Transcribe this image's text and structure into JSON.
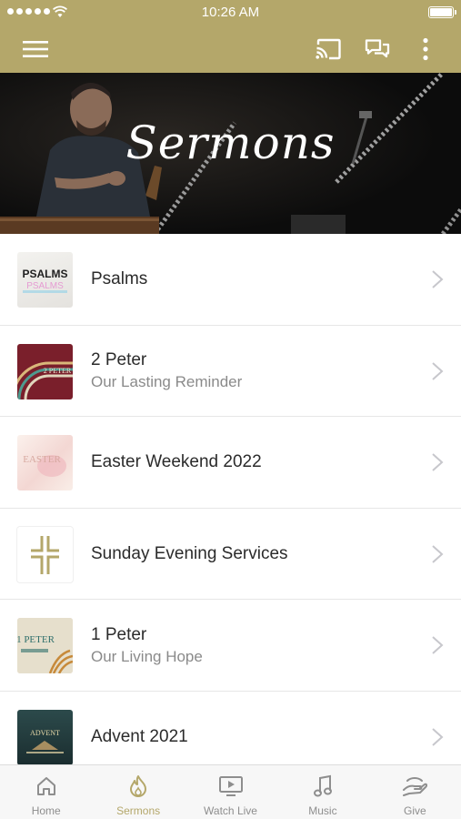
{
  "status_bar": {
    "time": "10:26 AM"
  },
  "header": {
    "hero_title": "Sermons",
    "icons": [
      "menu-icon",
      "cast-icon",
      "chat-icon",
      "more-vert-icon"
    ]
  },
  "sermon_series": [
    {
      "title": "Psalms",
      "subtitle": "",
      "thumb_text": "PSALMS"
    },
    {
      "title": "2 Peter",
      "subtitle": "Our Lasting Reminder",
      "thumb_text": "2 PETER"
    },
    {
      "title": "Easter Weekend 2022",
      "subtitle": "",
      "thumb_text": "EASTER"
    },
    {
      "title": "Sunday Evening Services",
      "subtitle": "",
      "thumb_text": ""
    },
    {
      "title": "1 Peter",
      "subtitle": "Our Living Hope",
      "thumb_text": "1 PETER"
    },
    {
      "title": "Advent 2021",
      "subtitle": "",
      "thumb_text": "ADVENT"
    }
  ],
  "tab_bar": [
    {
      "label": "Home",
      "icon": "home-icon",
      "active": false
    },
    {
      "label": "Sermons",
      "icon": "flame-icon",
      "active": true
    },
    {
      "label": "Watch Live",
      "icon": "tv-play-icon",
      "active": false
    },
    {
      "label": "Music",
      "icon": "music-note-icon",
      "active": false
    },
    {
      "label": "Give",
      "icon": "give-hand-icon",
      "active": false
    }
  ],
  "colors": {
    "accent": "#b4a76a",
    "hero_bg": "#0f0f0f",
    "tab_inactive": "#8e8e8e"
  }
}
